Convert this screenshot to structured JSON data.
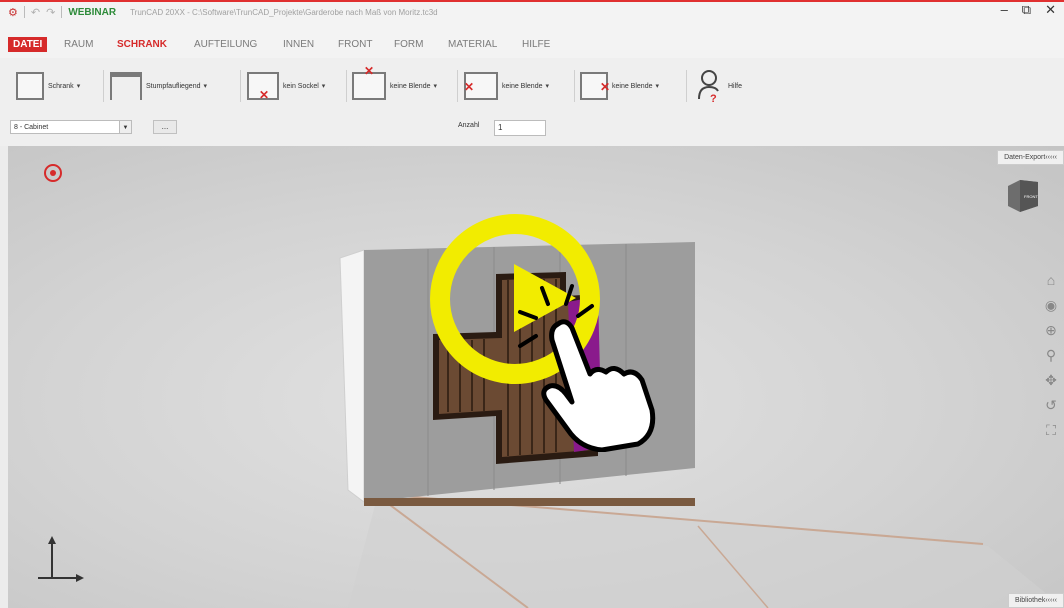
{
  "window": {
    "app_label": "WEBINAR",
    "title_path": "TrunCAD 20XX - C:\\Software\\TrunCAD_Projekte\\Garderobe nach Maß von Moritz.tc3d",
    "controls": [
      "–",
      "⧉",
      "✕"
    ]
  },
  "menu": {
    "tabs": [
      "DATEI",
      "RAUM",
      "SCHRANK",
      "AUFTEILUNG",
      "INNEN",
      "FRONT",
      "FORM",
      "MATERIAL",
      "HILFE"
    ],
    "active": "SCHRANK"
  },
  "ribbon": {
    "items": [
      {
        "label": "Schrank",
        "icon": "cabinet-icon"
      },
      {
        "label": "Stumpfaufliegend",
        "icon": "panel-icon"
      },
      {
        "label": "kein Sockel",
        "icon": "no-plinth-icon"
      },
      {
        "label": "keine Blende",
        "icon": "no-top-cover-icon"
      },
      {
        "label": "keine Blende",
        "icon": "no-left-cover-icon"
      },
      {
        "label": "keine Blende",
        "icon": "no-right-cover-icon"
      },
      {
        "label": "Hilfe",
        "icon": "help-person-icon"
      }
    ],
    "cabinet_select": "8 - Cabinet",
    "dots_button": "...",
    "anzahl_label": "Anzahl",
    "anzahl_value": "1"
  },
  "viewport": {
    "export_tab": "Daten-Export‹‹‹‹‹",
    "library_tab": "Bibliothek‹‹‹‹‹",
    "viewcube_label": "FRONT",
    "nav_icons": [
      "home-icon",
      "orbit-icon",
      "zoom-window-icon",
      "zoom-icon",
      "pan-icon",
      "rotate-icon",
      "fit-icon"
    ]
  },
  "colors": {
    "accent": "#d62a2a",
    "overlay_yellow": "#f2ec00",
    "door_purple": "#8a1a8c",
    "app_green": "#2e8b3a"
  }
}
